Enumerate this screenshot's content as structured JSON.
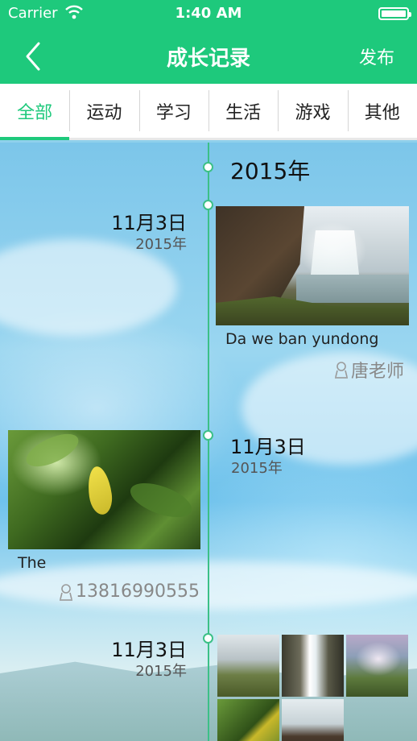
{
  "status_bar": {
    "carrier": "Carrier",
    "time": "1:40 AM"
  },
  "nav": {
    "title": "成长记录",
    "publish": "发布"
  },
  "tabs": [
    {
      "label": "全部",
      "active": true
    },
    {
      "label": "运动",
      "active": false
    },
    {
      "label": "学习",
      "active": false
    },
    {
      "label": "生活",
      "active": false
    },
    {
      "label": "游戏",
      "active": false
    },
    {
      "label": "其他",
      "active": false
    }
  ],
  "timeline": {
    "year_header": "2015年",
    "entries": [
      {
        "date": "11月3日",
        "year": "2015年",
        "caption": "Da we ban yundong",
        "author": "唐老师"
      },
      {
        "date": "11月3日",
        "year": "2015年",
        "caption": "The",
        "author": "13816990555"
      },
      {
        "date": "11月3日",
        "year": "2015年"
      }
    ]
  },
  "colors": {
    "accent": "#1ec97c",
    "timeline": "#3cc087"
  }
}
